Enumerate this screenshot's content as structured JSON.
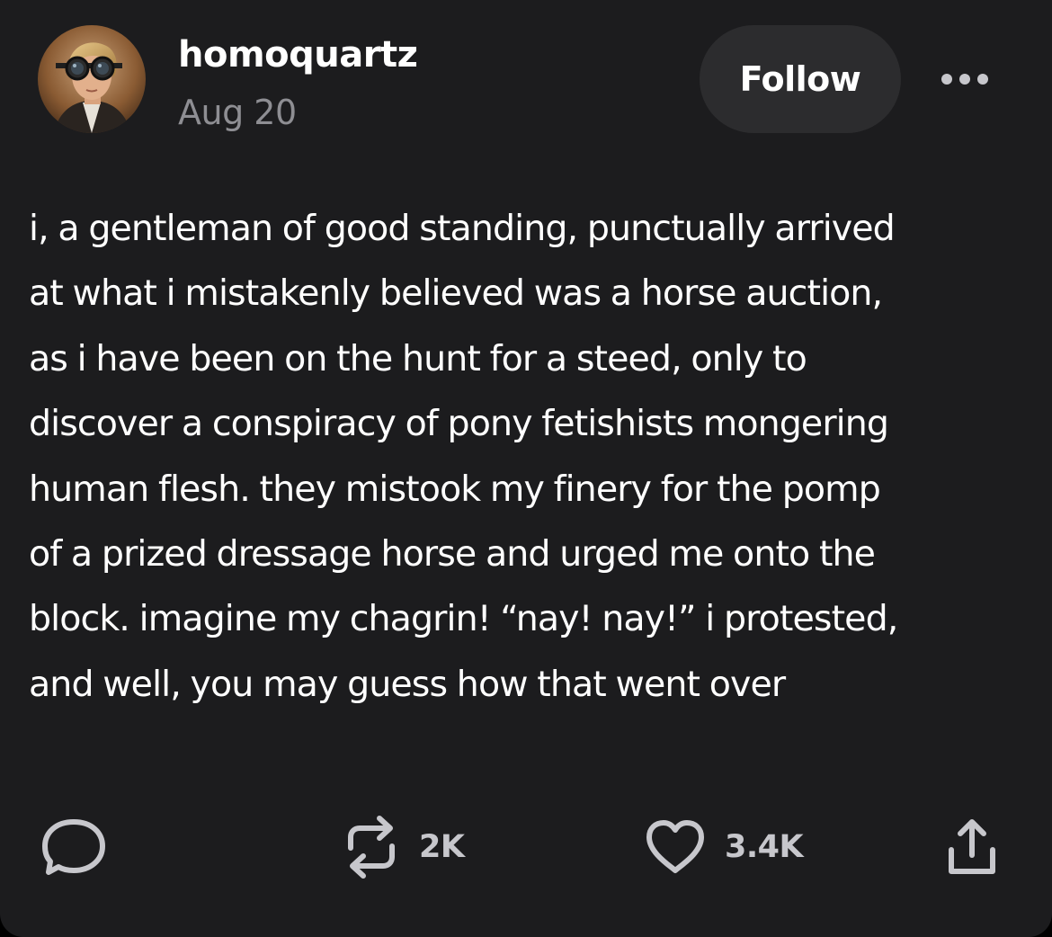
{
  "post": {
    "author": {
      "username": "homoquartz",
      "avatar_icon": "avatar-image"
    },
    "timestamp": "Aug 20",
    "follow_label": "Follow",
    "more_icon": "more-icon",
    "body_lines": [
      "i, a gentleman of good standing, punctually arrived",
      "at what i mistakenly believed was a horse auction,",
      "as i have been on the hunt for a steed, only to",
      "discover a conspiracy of pony fetishists mongering",
      "human flesh. they mistook my finery for the pomp",
      "of a prized dressage horse and urged me onto the",
      "block. imagine my chagrin! “nay! nay!” i protested,",
      "and well, you may guess how that went over"
    ],
    "actions": {
      "reply": {
        "icon": "reply-icon"
      },
      "reblog": {
        "icon": "reblog-icon",
        "count": "2K"
      },
      "like": {
        "icon": "heart-icon",
        "count": "3.4K"
      },
      "share": {
        "icon": "share-icon"
      }
    }
  },
  "colors": {
    "card_background": "#1c1c1e",
    "page_background": "#000000",
    "text_primary": "#ffffff",
    "text_secondary": "#8e8e93",
    "follow_button_background": "#2c2c2e",
    "icon_color": "#c7c7cc"
  }
}
